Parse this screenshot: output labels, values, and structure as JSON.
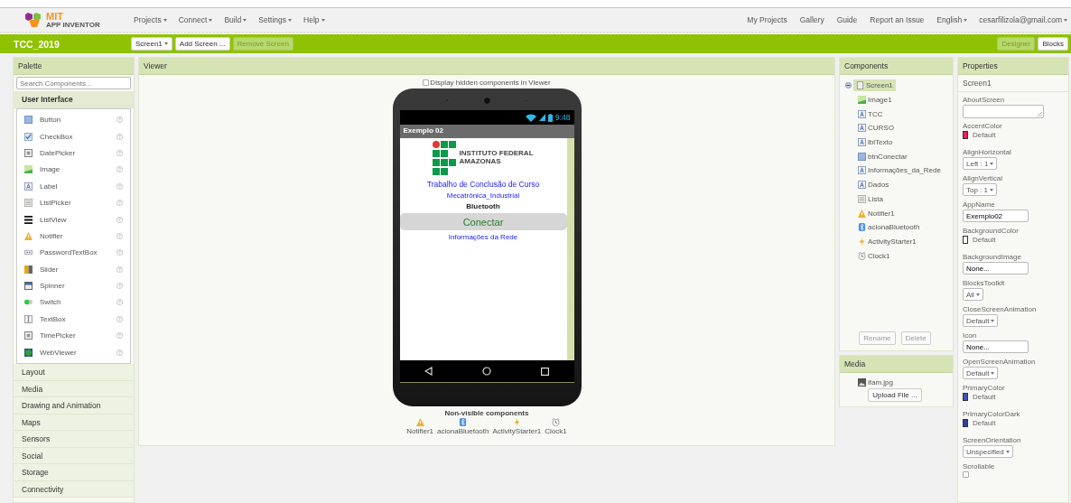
{
  "header": {
    "logo": {
      "title": "MIT",
      "subtitle": "APP INVENTOR"
    },
    "menus": [
      "Projects",
      "Connect",
      "Build",
      "Settings",
      "Help"
    ],
    "links": [
      "My Projects",
      "Gallery",
      "Guide",
      "Report an Issue"
    ],
    "language": "English",
    "account": "cesarfilizola@gmail.com"
  },
  "project_bar": {
    "title": "TCC_2019",
    "screen_select": "Screen1",
    "buttons": [
      {
        "label": "Add Screen ...",
        "disabled": false
      },
      {
        "label": "Remove Screen",
        "disabled": true
      }
    ],
    "modes": [
      {
        "label": "Designer",
        "selected": true
      },
      {
        "label": "Blocks",
        "selected": false
      }
    ]
  },
  "palette": {
    "title": "Palette",
    "search": {
      "placeholder": "Search Components..."
    },
    "categories": [
      {
        "label": "User Interface",
        "expanded": true,
        "items": [
          {
            "label": "Button",
            "kind": "button"
          },
          {
            "label": "CheckBox",
            "kind": "checkbox"
          },
          {
            "label": "DatePicker",
            "kind": "datepicker"
          },
          {
            "label": "Image",
            "kind": "image"
          },
          {
            "label": "Label",
            "kind": "label"
          },
          {
            "label": "ListPicker",
            "kind": "list"
          },
          {
            "label": "ListView",
            "kind": "listview"
          },
          {
            "label": "Notifier",
            "kind": "notifier"
          },
          {
            "label": "PasswordTextBox",
            "kind": "password"
          },
          {
            "label": "Slider",
            "kind": "slider"
          },
          {
            "label": "Spinner",
            "kind": "spinner"
          },
          {
            "label": "Switch",
            "kind": "switch"
          },
          {
            "label": "TextBox",
            "kind": "textbox"
          },
          {
            "label": "TimePicker",
            "kind": "datepicker"
          },
          {
            "label": "WebViewer",
            "kind": "web"
          }
        ]
      },
      {
        "label": "Layout",
        "expanded": false
      },
      {
        "label": "Media",
        "expanded": false
      },
      {
        "label": "Drawing and Animation",
        "expanded": false
      },
      {
        "label": "Maps",
        "expanded": false
      },
      {
        "label": "Sensors",
        "expanded": false
      },
      {
        "label": "Social",
        "expanded": false
      },
      {
        "label": "Storage",
        "expanded": false
      },
      {
        "label": "Connectivity",
        "expanded": false
      }
    ]
  },
  "viewer": {
    "title": "Viewer",
    "hidden_toggle": {
      "label": "Display hidden components in Viewer",
      "checked": false
    },
    "phone": {
      "time": "9:48",
      "app_title": "Exemplo 02",
      "logo_lines": [
        "INSTITUTO FEDERAL",
        "AMAZONAS"
      ],
      "contents": [
        {
          "kind": "title",
          "text": "Trabalho de Conclusão de Curso"
        },
        {
          "kind": "label",
          "text": "Mecatrônica_Industrial"
        },
        {
          "kind": "caption",
          "text": "Bluetooth"
        },
        {
          "kind": "button",
          "text": "Conectar"
        },
        {
          "kind": "label",
          "text": "Informações da Rede"
        }
      ]
    },
    "non_visible": {
      "title": "Non-visible components",
      "items": [
        {
          "label": "Notifier1",
          "kind": "notifier"
        },
        {
          "label": "acionaBluetooth",
          "kind": "bluetooth"
        },
        {
          "label": "ActivityStarter1",
          "kind": "activity"
        },
        {
          "label": "Clock1",
          "kind": "clock"
        }
      ]
    }
  },
  "components": {
    "title": "Components",
    "tree": [
      {
        "label": "Screen1",
        "kind": "screen",
        "selected": true,
        "expanded": true,
        "children": [
          {
            "label": "Image1",
            "kind": "image",
            "selected": false
          },
          {
            "label": "TCC",
            "kind": "label",
            "selected": false
          },
          {
            "label": "CURSO",
            "kind": "label",
            "selected": false
          },
          {
            "label": "lblTexto",
            "kind": "label",
            "selected": false
          },
          {
            "label": "btnConectar",
            "kind": "button",
            "selected": false
          },
          {
            "label": "Informações_da_Rede",
            "kind": "label",
            "selected": false
          },
          {
            "label": "Dados",
            "kind": "label",
            "selected": false
          },
          {
            "label": "Lista",
            "kind": "list",
            "selected": false
          },
          {
            "label": "Notifier1",
            "kind": "notifier",
            "selected": false
          },
          {
            "label": "acionaBluetooth",
            "kind": "bluetooth",
            "selected": false
          },
          {
            "label": "ActivityStarter1",
            "kind": "activity",
            "selected": false
          },
          {
            "label": "Clock1",
            "kind": "clock",
            "selected": false
          }
        ]
      }
    ],
    "buttons": [
      {
        "label": "Rename",
        "disabled": true
      },
      {
        "label": "Delete",
        "disabled": true
      }
    ]
  },
  "media": {
    "title": "Media",
    "files": [
      "ifam.jpg"
    ],
    "upload_button": "Upload File ..."
  },
  "properties": {
    "title": "Properties",
    "subject": "Screen1",
    "items": [
      {
        "kind": "textarea",
        "label": "AboutScreen"
      },
      {
        "kind": "color",
        "label": "AccentColor",
        "value": "Default",
        "color": "#e91e63"
      },
      {
        "kind": "dropdown",
        "label": "AlignHorizontal",
        "value": "Left : 1"
      },
      {
        "kind": "dropdown",
        "label": "AlignVertical",
        "value": "Top : 1"
      },
      {
        "kind": "text",
        "label": "AppName",
        "value": "Exemplo02"
      },
      {
        "kind": "color",
        "label": "BackgroundColor",
        "value": "Default",
        "color": "#ffffff"
      },
      {
        "kind": "text",
        "label": "BackgroundImage",
        "value": "None..."
      },
      {
        "kind": "dropdown",
        "label": "BlocksToolkit",
        "value": "All"
      },
      {
        "kind": "dropdown",
        "label": "CloseScreenAnimation",
        "value": "Default"
      },
      {
        "kind": "text",
        "label": "Icon",
        "value": "None..."
      },
      {
        "kind": "dropdown",
        "label": "OpenScreenAnimation",
        "value": "Default"
      },
      {
        "kind": "color",
        "label": "PrimaryColor",
        "value": "Default",
        "color": "#3f51b5"
      },
      {
        "kind": "color",
        "label": "PrimaryColorDark",
        "value": "Default",
        "color": "#303f9f"
      },
      {
        "kind": "dropdown",
        "label": "ScreenOrientation",
        "value": "Unspecified"
      },
      {
        "kind": "checkbox",
        "label": "Scrollable",
        "checked": false
      }
    ]
  }
}
